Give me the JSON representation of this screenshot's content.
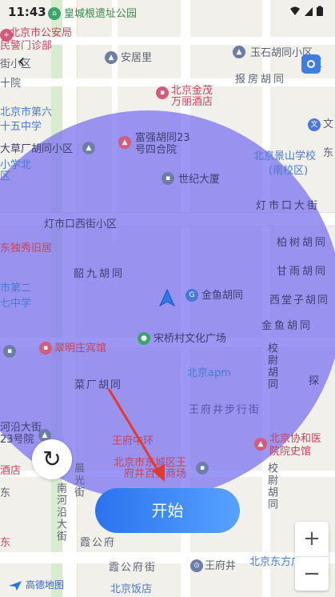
{
  "status": {
    "time": "11:43"
  },
  "map": {
    "labels": {
      "l1": "皇城根遗址公园",
      "l2a": "北京市公安局",
      "l2b": "民警门诊部",
      "l3": "安居里",
      "l4": "玉石胡同小区",
      "l5": "报房胡同",
      "l6a": "北京金茂",
      "l6b": "万丽酒店",
      "l7a": "北京市第六",
      "l7b": "十五中学",
      "l8a": "富强胡同23",
      "l8b": "号四合院",
      "l9": "大草厂胡同小区",
      "l10a": "北京景山学校",
      "l10b": "(南校区)",
      "l11a": "小学北",
      "l11b": "区",
      "l12": "世纪大厦",
      "l13": "灯市口大街",
      "l14": "灯市口西街小区",
      "l15": "柏树胡同",
      "l16": "东独秀旧居",
      "l17": "甘雨胡同",
      "l18": "韶九胡同",
      "l19a": "市第二",
      "l19b": "七中学",
      "l20": "金鱼胡同",
      "l21": "西堂子胡同",
      "l22": "金鱼胡同",
      "l23": "宋桥村文化广场",
      "l24": "翠明庄宾馆",
      "l25": "校尉胡同",
      "l26": "北京apm",
      "l27": "菜厂胡同",
      "l28": "王府井步行街",
      "l29a": "河沿大街",
      "l29b": "23号院",
      "l30": "王府中环",
      "l31a": "北京协和医",
      "l31b": "院院史馆",
      "l32a": "北京市东城区王",
      "l32b": "府井百货商场",
      "l33": "晨光街",
      "l34": "校尉胡同",
      "l35": "南河沿大街",
      "l36": "霞公府",
      "l37": "霞公府街",
      "l38": "王府井",
      "l39": "北京东方广场",
      "l40": "北京饭店",
      "l41": "酒店",
      "l42": "十院",
      "l43": "街小区",
      "l44": "东",
      "l45": "文",
      "l46": "东",
      "l47": "小区",
      "l48": "探",
      "l49": "东"
    }
  },
  "controls": {
    "back": "‹",
    "refresh": "↻",
    "start": "开始",
    "zoom_in": "+",
    "zoom_out": "−",
    "logo": "高德地图"
  }
}
